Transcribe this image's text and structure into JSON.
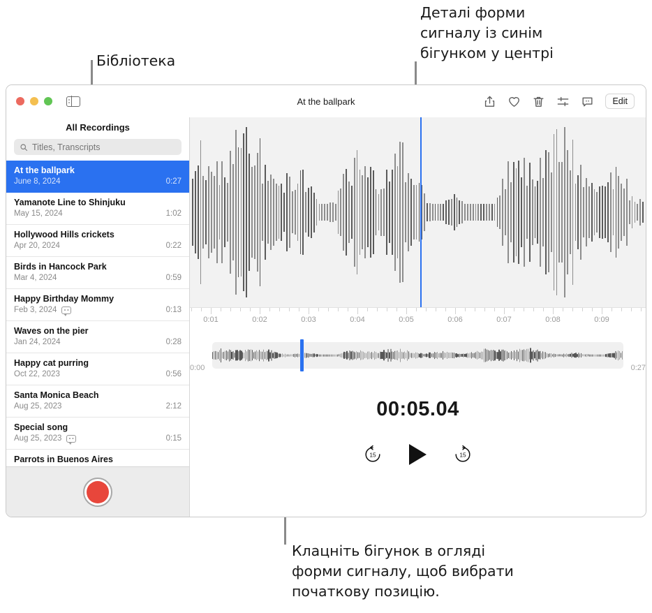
{
  "callouts": {
    "library": "Бібліотека",
    "waveform_detail": "Деталі форми\nсигналу із синім\nбігунком у центрі",
    "scrubber": "Клацніть бігунок в огляді\nформи сигналу, щоб вибрати\nпочаткову позицію."
  },
  "window": {
    "title": "At the ballpark",
    "traffic_lights": [
      "close",
      "minimize",
      "zoom"
    ],
    "toolbar": {
      "sidebar_toggle": "sidebar-toggle-icon",
      "icons": [
        "share-icon",
        "heart-icon",
        "trash-icon",
        "sliders-icon",
        "transcript-icon"
      ],
      "edit_label": "Edit"
    }
  },
  "sidebar": {
    "header": "All Recordings",
    "search": {
      "placeholder": "Titles, Transcripts",
      "value": ""
    },
    "recordings": [
      {
        "title": "At the ballpark",
        "date": "June 8, 2024",
        "duration": "0:27",
        "selected": true,
        "transcript": false
      },
      {
        "title": "Yamanote Line to Shinjuku",
        "date": "May 15, 2024",
        "duration": "1:02",
        "selected": false,
        "transcript": false
      },
      {
        "title": "Hollywood Hills crickets",
        "date": "Apr 20, 2024",
        "duration": "0:22",
        "selected": false,
        "transcript": false
      },
      {
        "title": "Birds in Hancock Park",
        "date": "Mar 4, 2024",
        "duration": "0:59",
        "selected": false,
        "transcript": false
      },
      {
        "title": "Happy Birthday Mommy",
        "date": "Feb 3, 2024",
        "duration": "0:13",
        "selected": false,
        "transcript": true
      },
      {
        "title": "Waves on the pier",
        "date": "Jan 24, 2024",
        "duration": "0:28",
        "selected": false,
        "transcript": false
      },
      {
        "title": "Happy cat purring",
        "date": "Oct 22, 2023",
        "duration": "0:56",
        "selected": false,
        "transcript": false
      },
      {
        "title": "Santa Monica Beach",
        "date": "Aug 25, 2023",
        "duration": "2:12",
        "selected": false,
        "transcript": false
      },
      {
        "title": "Special song",
        "date": "Aug 25, 2023",
        "duration": "0:15",
        "selected": false,
        "transcript": true
      },
      {
        "title": "Parrots in Buenos Aires",
        "date": "",
        "duration": "",
        "selected": false,
        "transcript": false
      }
    ],
    "record_button": "record-button"
  },
  "player": {
    "timecode": "00:05.04",
    "ruler_labels": [
      "0:01",
      "0:02",
      "0:03",
      "0:04",
      "0:05",
      "0:06",
      "0:07",
      "0:08",
      "0:09"
    ],
    "overview_start": "0:00",
    "overview_end": "0:27",
    "skip_back_label": "15",
    "skip_forward_label": "15",
    "play_label": "play-button",
    "playhead_time": "0:05"
  },
  "colors": {
    "accent_blue": "#2a71f0",
    "record_red": "#e8463b",
    "waveform_gray": "#6b6b6b",
    "panel_bg": "#f2f2f2"
  }
}
